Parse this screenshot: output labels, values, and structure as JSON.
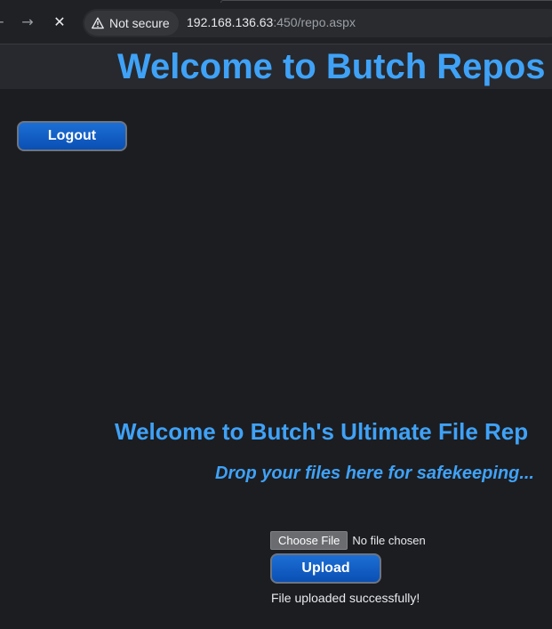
{
  "browser": {
    "security_label": "Not secure",
    "url_host": "192.168.136.63",
    "url_rest": ":450/repo.aspx",
    "back_glyph": "←",
    "forward_glyph": "→",
    "stop_glyph": "✕",
    "icons": [
      "back-arrow-icon",
      "forward-arrow-icon",
      "close-icon",
      "warning-icon"
    ]
  },
  "header": {
    "title": "Welcome to Butch Repos"
  },
  "actions": {
    "logout_label": "Logout"
  },
  "main": {
    "welcome": "Welcome to Butch's Ultimate File Rep",
    "tagline": "Drop your files here for safekeeping..."
  },
  "upload": {
    "choose_label": "Choose File",
    "no_file_text": "No file chosen",
    "upload_label": "Upload",
    "status": "File uploaded successfully!"
  },
  "colors": {
    "accent": "#3fa2f7",
    "button": "#0a4fb3",
    "background": "#1c1d21"
  }
}
